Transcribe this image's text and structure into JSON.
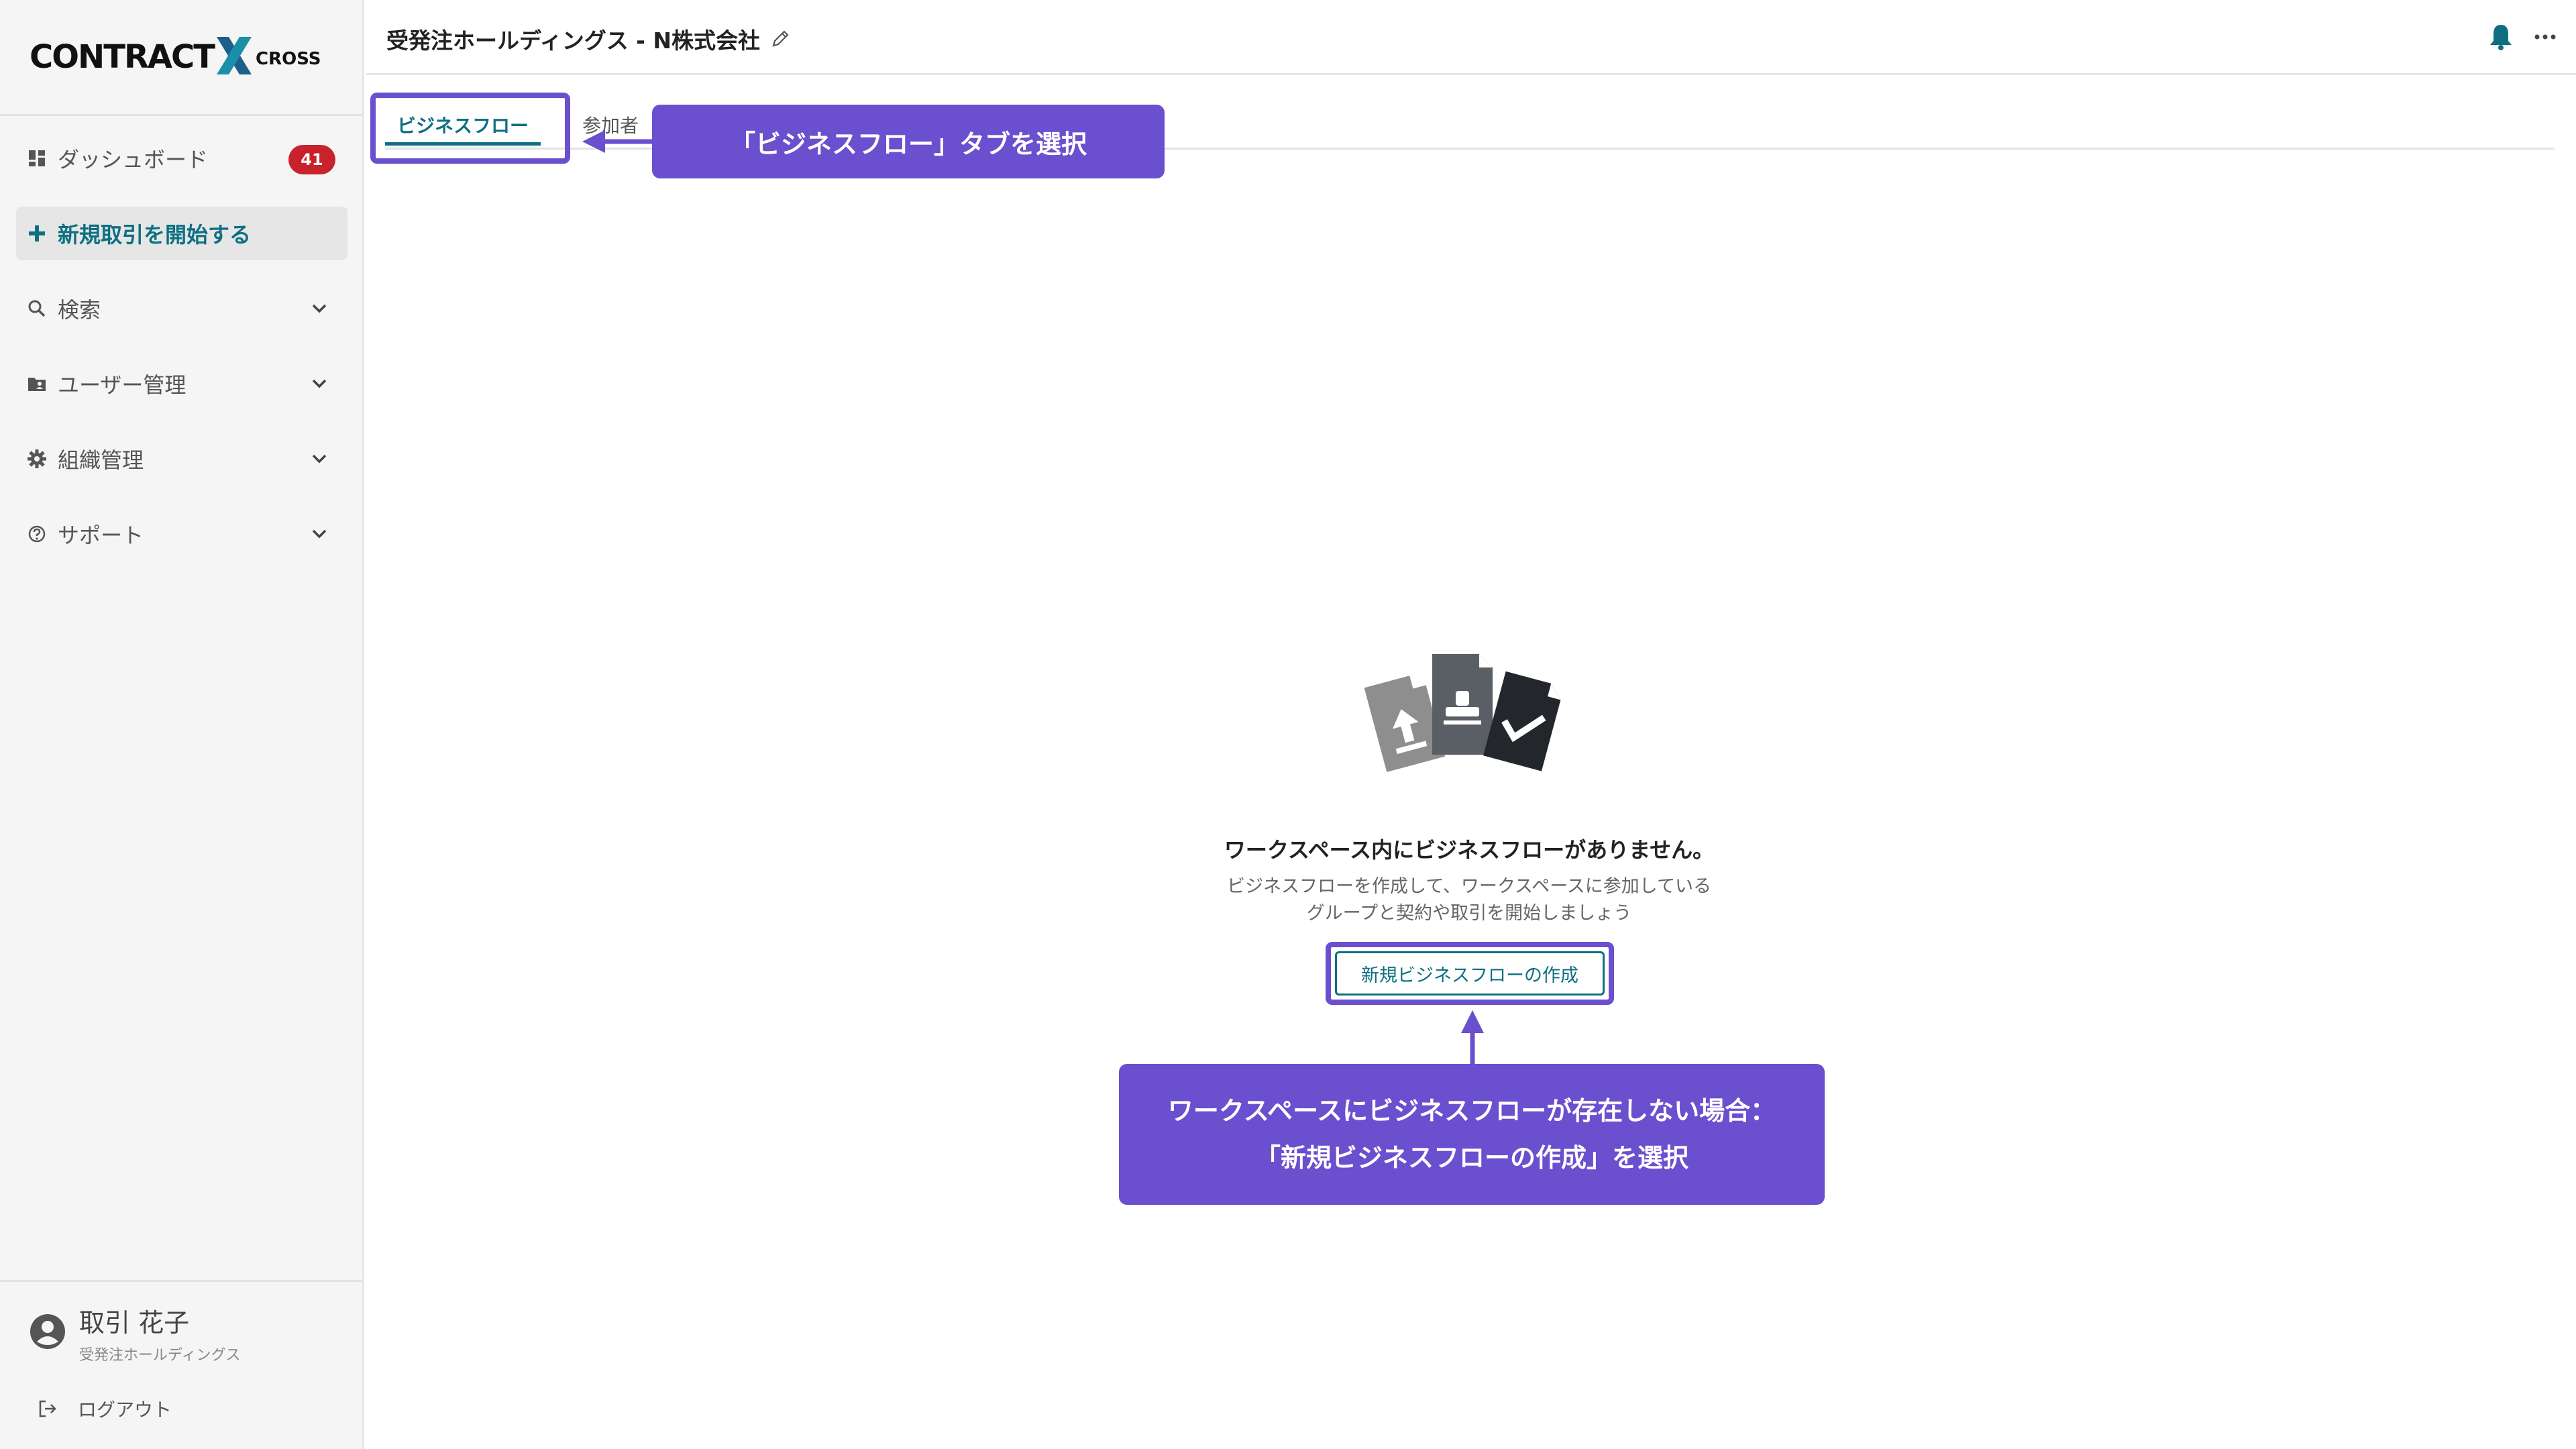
{
  "app": {
    "logo_text": "CONTRACT",
    "logo_x": "X",
    "logo_sub": "CROSS"
  },
  "sidebar": {
    "items": [
      {
        "label": "ダッシュボード",
        "badge": "41",
        "icon": "dashboard-icon"
      },
      {
        "label": "新規取引を開始する",
        "icon": "plus-icon"
      },
      {
        "label": "検索",
        "icon": "search-icon"
      },
      {
        "label": "ユーザー管理",
        "icon": "folder-user-icon"
      },
      {
        "label": "組織管理",
        "icon": "gear-icon"
      },
      {
        "label": "サポート",
        "icon": "help-icon"
      }
    ],
    "user": {
      "name": "取引 花子",
      "org": "受発注ホールディングス"
    },
    "logout_label": "ログアウト"
  },
  "header": {
    "workspace_title": "受発注ホールディングス - N株式会社"
  },
  "tabs": [
    {
      "label": "ビジネスフロー",
      "active": true
    },
    {
      "label": "参加者",
      "active": false
    }
  ],
  "empty_state": {
    "title": "ワークスペース内にビジネスフローがありません。",
    "desc_line1": "ビジネスフローを作成して、ワークスペースに参加している",
    "desc_line2": "グループと契約や取引を開始しましょう",
    "button_label": "新規ビジネスフローの作成"
  },
  "annotations": {
    "tab_callout": "「ビジネスフロー」タブを選択",
    "button_callout_line1": "ワークスペースにビジネスフローが存在しない場合：",
    "button_callout_line2": "「新規ビジネスフローの作成」を選択"
  },
  "colors": {
    "accent": "#0e6f82",
    "annotation": "#6a4fcf",
    "badge": "#c8232c"
  }
}
